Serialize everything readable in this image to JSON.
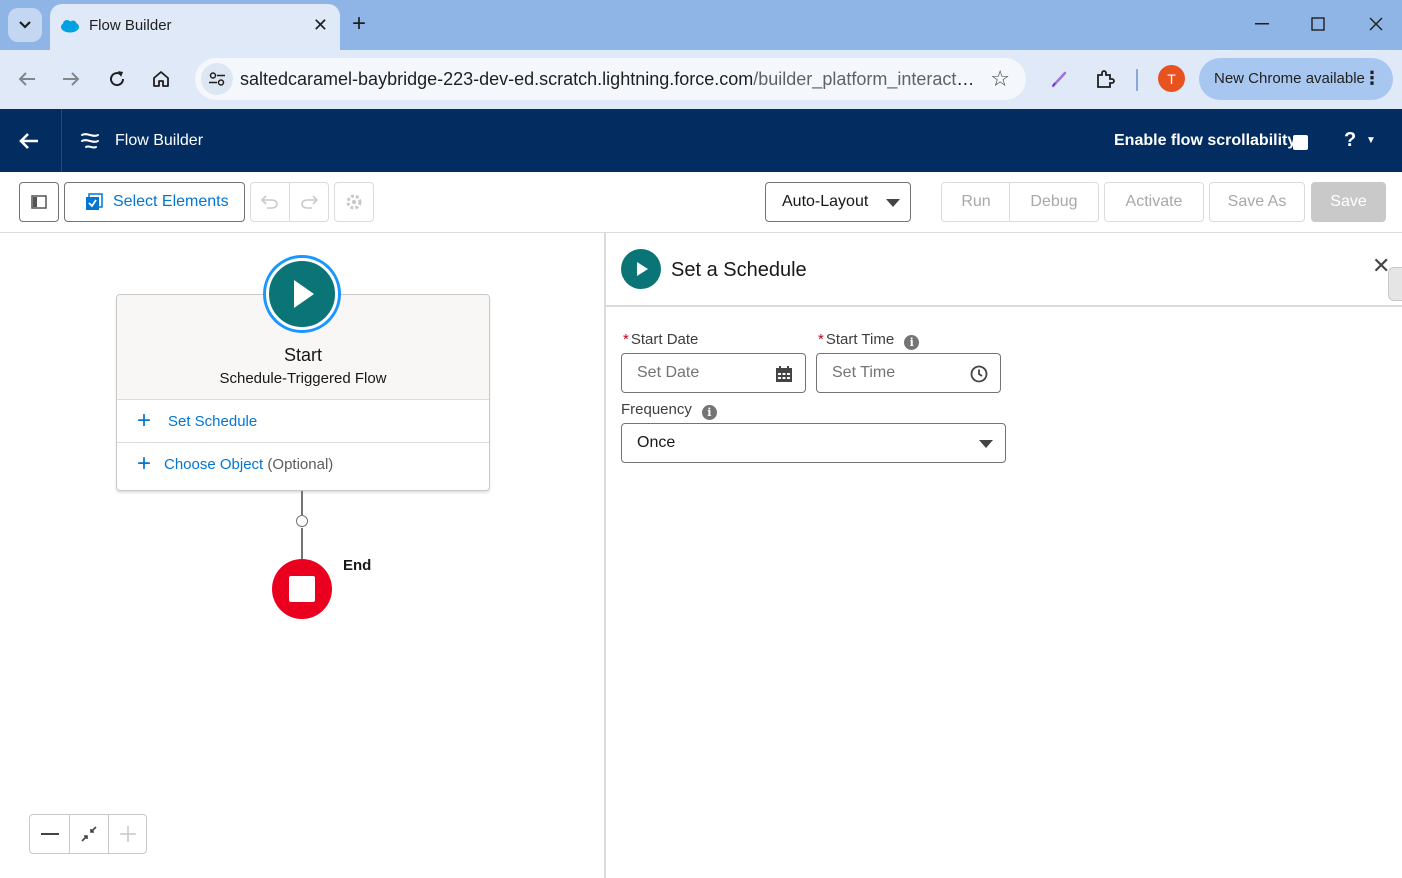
{
  "browser": {
    "tab_title": "Flow Builder",
    "url_host": "saltedcaramel-baybridge-223-dev-ed.scratch.lightning.force.com",
    "url_path": "/builder_platform_interaction...",
    "profile_initial": "T",
    "update_label": "New Chrome available"
  },
  "header": {
    "title": "Flow Builder",
    "scroll_label": "Enable flow scrollability",
    "help_label": "?"
  },
  "toolbar": {
    "select_elements": "Select Elements",
    "layout_value": "Auto-Layout",
    "run": "Run",
    "debug": "Debug",
    "activate": "Activate",
    "save_as": "Save As",
    "save": "Save"
  },
  "canvas": {
    "start_label": "Start",
    "start_type": "Schedule-Triggered Flow",
    "set_schedule": "Set Schedule",
    "choose_object": "Choose Object",
    "optional": "(Optional)",
    "end_label": "End"
  },
  "panel": {
    "title": "Set a Schedule",
    "start_date_label": "Start Date",
    "start_date_placeholder": "Set Date",
    "start_time_label": "Start Time",
    "start_time_placeholder": "Set Time",
    "frequency_label": "Frequency",
    "frequency_value": "Once",
    "required_mark": "*",
    "info_glyph": "i"
  },
  "colors": {
    "header_bg": "#032d60",
    "brand_blue": "#0176d3",
    "start_teal": "#0b7477",
    "end_red": "#ea001e",
    "chrome_frame": "#8fb4e6"
  }
}
